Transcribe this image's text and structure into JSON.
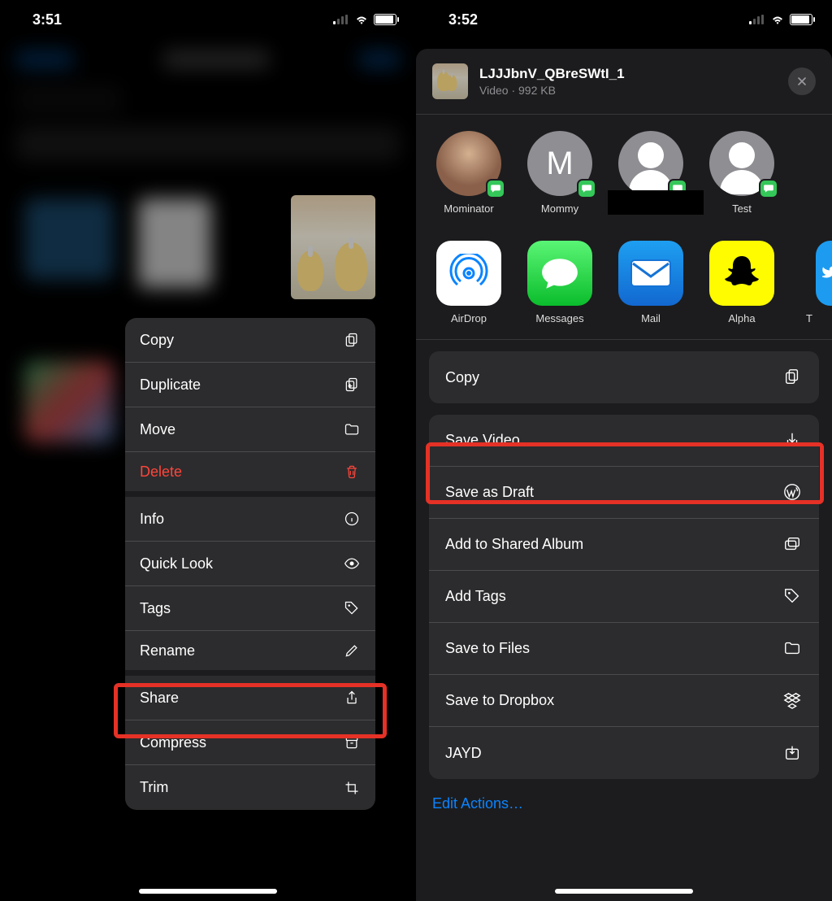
{
  "left": {
    "status": {
      "time": "3:51"
    },
    "menu": {
      "copy": "Copy",
      "duplicate": "Duplicate",
      "move": "Move",
      "delete": "Delete",
      "info": "Info",
      "quicklook": "Quick Look",
      "tags": "Tags",
      "rename": "Rename",
      "share": "Share",
      "compress": "Compress",
      "trim": "Trim"
    }
  },
  "right": {
    "status": {
      "time": "3:52"
    },
    "file": {
      "name": "LJJJbnV_QBreSWtI_1",
      "subtitle": "Video · 992 KB"
    },
    "people": [
      {
        "name": "Mominator"
      },
      {
        "name": "Mommy",
        "initial": "M"
      },
      {
        "name": ""
      },
      {
        "name": "Test"
      }
    ],
    "apps": [
      {
        "name": "AirDrop"
      },
      {
        "name": "Messages"
      },
      {
        "name": "Mail"
      },
      {
        "name": "Alpha"
      },
      {
        "name": "T"
      }
    ],
    "actions": {
      "copy": "Copy",
      "save_video": "Save Video",
      "save_draft": "Save as Draft",
      "shared_album": "Add to Shared Album",
      "add_tags": "Add Tags",
      "save_files": "Save to Files",
      "save_dropbox": "Save to Dropbox",
      "jayd": "JAYD"
    },
    "edit_actions": "Edit Actions…"
  }
}
